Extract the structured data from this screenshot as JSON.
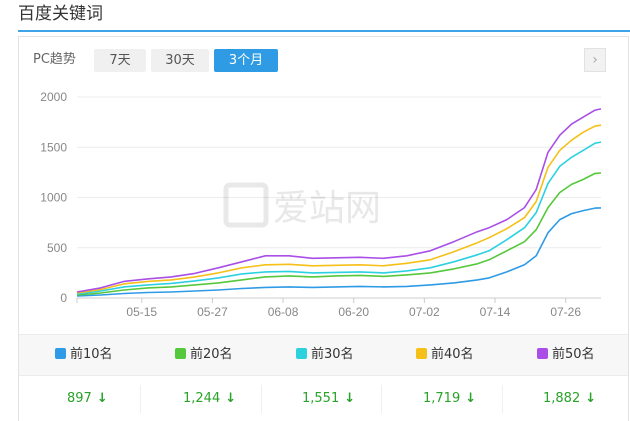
{
  "page": {
    "title": "百度关键词"
  },
  "toolbar": {
    "source_label": "PC趋势",
    "ranges": [
      {
        "label": "7天",
        "active": false
      },
      {
        "label": "30天",
        "active": false
      },
      {
        "label": "3个月",
        "active": true
      }
    ],
    "next_icon": "chevron-right-icon",
    "next_glyph": "›"
  },
  "watermark": "爱站网",
  "legend": [
    {
      "label": "前10名",
      "color": "#2f9be6",
      "value": "897",
      "trend": "down",
      "arrow": "↓"
    },
    {
      "label": "前20名",
      "color": "#56c83b",
      "value": "1,244",
      "trend": "down",
      "arrow": "↓"
    },
    {
      "label": "前30名",
      "color": "#2cd1e0",
      "value": "1,551",
      "trend": "down",
      "arrow": "↓"
    },
    {
      "label": "前40名",
      "color": "#f5c017",
      "value": "1,719",
      "trend": "down",
      "arrow": "↓"
    },
    {
      "label": "前50名",
      "color": "#a94ee6",
      "value": "1,882",
      "trend": "down",
      "arrow": "↓"
    }
  ],
  "chart_data": {
    "type": "line",
    "x_ticks": [
      "05-15",
      "05-27",
      "06-08",
      "06-20",
      "07-02",
      "07-14",
      "07-26"
    ],
    "y_ticks": [
      "0",
      "500",
      "1000",
      "1500",
      "2000"
    ],
    "ylim": [
      0,
      2000
    ],
    "x_domain_days": [
      0,
      84
    ],
    "x_tick_days": [
      11,
      23,
      35,
      47,
      59,
      71,
      83
    ],
    "grid": true,
    "series": [
      {
        "name": "前10名",
        "color": "#2f9be6",
        "points": [
          [
            0,
            20
          ],
          [
            4,
            30
          ],
          [
            8,
            45
          ],
          [
            12,
            55
          ],
          [
            16,
            60
          ],
          [
            20,
            70
          ],
          [
            24,
            80
          ],
          [
            28,
            95
          ],
          [
            32,
            105
          ],
          [
            36,
            110
          ],
          [
            40,
            105
          ],
          [
            44,
            110
          ],
          [
            48,
            115
          ],
          [
            52,
            110
          ],
          [
            56,
            115
          ],
          [
            60,
            130
          ],
          [
            64,
            150
          ],
          [
            68,
            180
          ],
          [
            70,
            200
          ],
          [
            73,
            260
          ],
          [
            76,
            330
          ],
          [
            78,
            420
          ],
          [
            80,
            650
          ],
          [
            82,
            780
          ],
          [
            84,
            840
          ],
          [
            86,
            870
          ],
          [
            88,
            895
          ],
          [
            89,
            897
          ]
        ]
      },
      {
        "name": "前20名",
        "color": "#56c83b",
        "points": [
          [
            0,
            30
          ],
          [
            4,
            50
          ],
          [
            8,
            80
          ],
          [
            12,
            100
          ],
          [
            16,
            110
          ],
          [
            20,
            130
          ],
          [
            24,
            150
          ],
          [
            28,
            180
          ],
          [
            32,
            210
          ],
          [
            36,
            220
          ],
          [
            40,
            210
          ],
          [
            44,
            220
          ],
          [
            48,
            225
          ],
          [
            52,
            215
          ],
          [
            56,
            230
          ],
          [
            60,
            250
          ],
          [
            64,
            290
          ],
          [
            68,
            340
          ],
          [
            70,
            380
          ],
          [
            73,
            470
          ],
          [
            76,
            560
          ],
          [
            78,
            680
          ],
          [
            80,
            900
          ],
          [
            82,
            1050
          ],
          [
            84,
            1130
          ],
          [
            86,
            1180
          ],
          [
            88,
            1240
          ],
          [
            89,
            1244
          ]
        ]
      },
      {
        "name": "前30名",
        "color": "#2cd1e0",
        "points": [
          [
            0,
            40
          ],
          [
            4,
            70
          ],
          [
            8,
            110
          ],
          [
            12,
            130
          ],
          [
            16,
            145
          ],
          [
            20,
            170
          ],
          [
            24,
            200
          ],
          [
            28,
            240
          ],
          [
            32,
            260
          ],
          [
            36,
            265
          ],
          [
            40,
            250
          ],
          [
            44,
            255
          ],
          [
            48,
            260
          ],
          [
            52,
            250
          ],
          [
            56,
            270
          ],
          [
            60,
            300
          ],
          [
            64,
            360
          ],
          [
            68,
            430
          ],
          [
            70,
            470
          ],
          [
            73,
            580
          ],
          [
            76,
            700
          ],
          [
            78,
            850
          ],
          [
            80,
            1140
          ],
          [
            82,
            1310
          ],
          [
            84,
            1400
          ],
          [
            86,
            1470
          ],
          [
            88,
            1540
          ],
          [
            89,
            1551
          ]
        ]
      },
      {
        "name": "前40名",
        "color": "#f5c017",
        "points": [
          [
            0,
            50
          ],
          [
            4,
            85
          ],
          [
            8,
            140
          ],
          [
            12,
            165
          ],
          [
            16,
            180
          ],
          [
            20,
            210
          ],
          [
            24,
            250
          ],
          [
            28,
            300
          ],
          [
            32,
            330
          ],
          [
            36,
            335
          ],
          [
            40,
            320
          ],
          [
            44,
            325
          ],
          [
            48,
            330
          ],
          [
            52,
            320
          ],
          [
            56,
            345
          ],
          [
            60,
            380
          ],
          [
            64,
            460
          ],
          [
            68,
            550
          ],
          [
            70,
            600
          ],
          [
            73,
            690
          ],
          [
            76,
            800
          ],
          [
            78,
            960
          ],
          [
            80,
            1300
          ],
          [
            82,
            1470
          ],
          [
            84,
            1570
          ],
          [
            86,
            1650
          ],
          [
            88,
            1710
          ],
          [
            89,
            1719
          ]
        ]
      },
      {
        "name": "前50名",
        "color": "#a94ee6",
        "points": [
          [
            0,
            60
          ],
          [
            4,
            100
          ],
          [
            8,
            165
          ],
          [
            12,
            190
          ],
          [
            16,
            210
          ],
          [
            20,
            245
          ],
          [
            24,
            300
          ],
          [
            28,
            360
          ],
          [
            32,
            420
          ],
          [
            36,
            420
          ],
          [
            40,
            395
          ],
          [
            44,
            400
          ],
          [
            48,
            405
          ],
          [
            52,
            395
          ],
          [
            56,
            420
          ],
          [
            60,
            470
          ],
          [
            64,
            560
          ],
          [
            68,
            660
          ],
          [
            70,
            700
          ],
          [
            73,
            780
          ],
          [
            76,
            900
          ],
          [
            78,
            1080
          ],
          [
            80,
            1450
          ],
          [
            82,
            1620
          ],
          [
            84,
            1730
          ],
          [
            86,
            1800
          ],
          [
            88,
            1870
          ],
          [
            89,
            1882
          ]
        ]
      }
    ]
  }
}
